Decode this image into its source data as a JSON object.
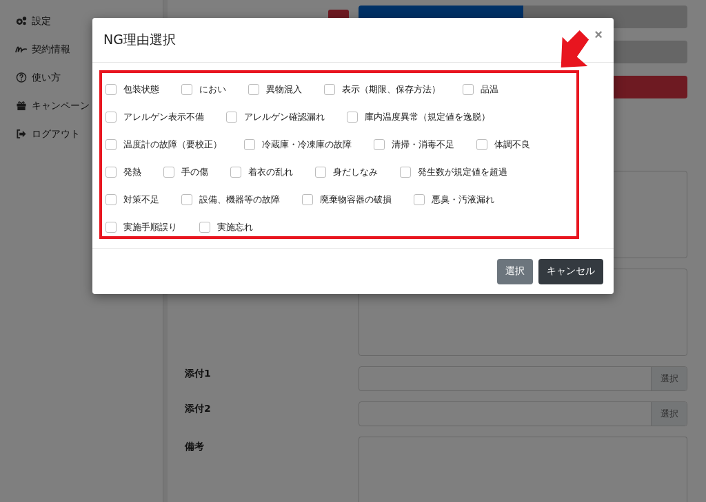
{
  "sidebar": {
    "items": [
      {
        "label": "設定"
      },
      {
        "label": "契約情報"
      },
      {
        "label": "使い方"
      },
      {
        "label": "キャンペーン"
      },
      {
        "label": "ログアウト"
      }
    ]
  },
  "form": {
    "top_row": {
      "options": [
        {
          "selected": true
        },
        {
          "selected": false
        }
      ]
    },
    "attachments": [
      {
        "label": "添付1",
        "button": "選択"
      },
      {
        "label": "添付2",
        "button": "選択"
      }
    ],
    "remarks": {
      "label": "備考"
    }
  },
  "modal": {
    "title": "NG理由選択",
    "close": "×",
    "reason_rows": [
      [
        {
          "label": "包装状態",
          "checked": false
        },
        {
          "label": "におい",
          "checked": false
        },
        {
          "label": "異物混入",
          "checked": false
        },
        {
          "label": "表示（期限、保存方法）",
          "checked": false
        },
        {
          "label": "品温",
          "checked": false
        }
      ],
      [
        {
          "label": "アレルゲン表示不備",
          "checked": false
        },
        {
          "label": "アレルゲン確認漏れ",
          "checked": false
        },
        {
          "label": "庫内温度異常（規定値を逸脱）",
          "checked": false
        }
      ],
      [
        {
          "label": "温度計の故障（要校正）",
          "checked": false
        },
        {
          "label": "冷蔵庫・冷凍庫の故障",
          "checked": false
        },
        {
          "label": "清掃・消毒不足",
          "checked": false
        },
        {
          "label": "体調不良",
          "checked": false
        }
      ],
      [
        {
          "label": "発熱",
          "checked": false
        },
        {
          "label": "手の傷",
          "checked": false
        },
        {
          "label": "着衣の乱れ",
          "checked": false
        },
        {
          "label": "身だしなみ",
          "checked": false
        },
        {
          "label": "発生数が規定値を超過",
          "checked": false
        }
      ],
      [
        {
          "label": "対策不足",
          "checked": false
        },
        {
          "label": "設備、機器等の故障",
          "checked": false
        },
        {
          "label": "廃棄物容器の破損",
          "checked": false
        },
        {
          "label": "悪臭・汚液漏れ",
          "checked": false
        }
      ],
      [
        {
          "label": "実施手順誤り",
          "checked": false
        },
        {
          "label": "実施忘れ",
          "checked": false
        }
      ]
    ],
    "buttons": [
      {
        "label": "選択",
        "kind": "secondary"
      },
      {
        "label": "キャンセル",
        "kind": "dark"
      }
    ]
  }
}
